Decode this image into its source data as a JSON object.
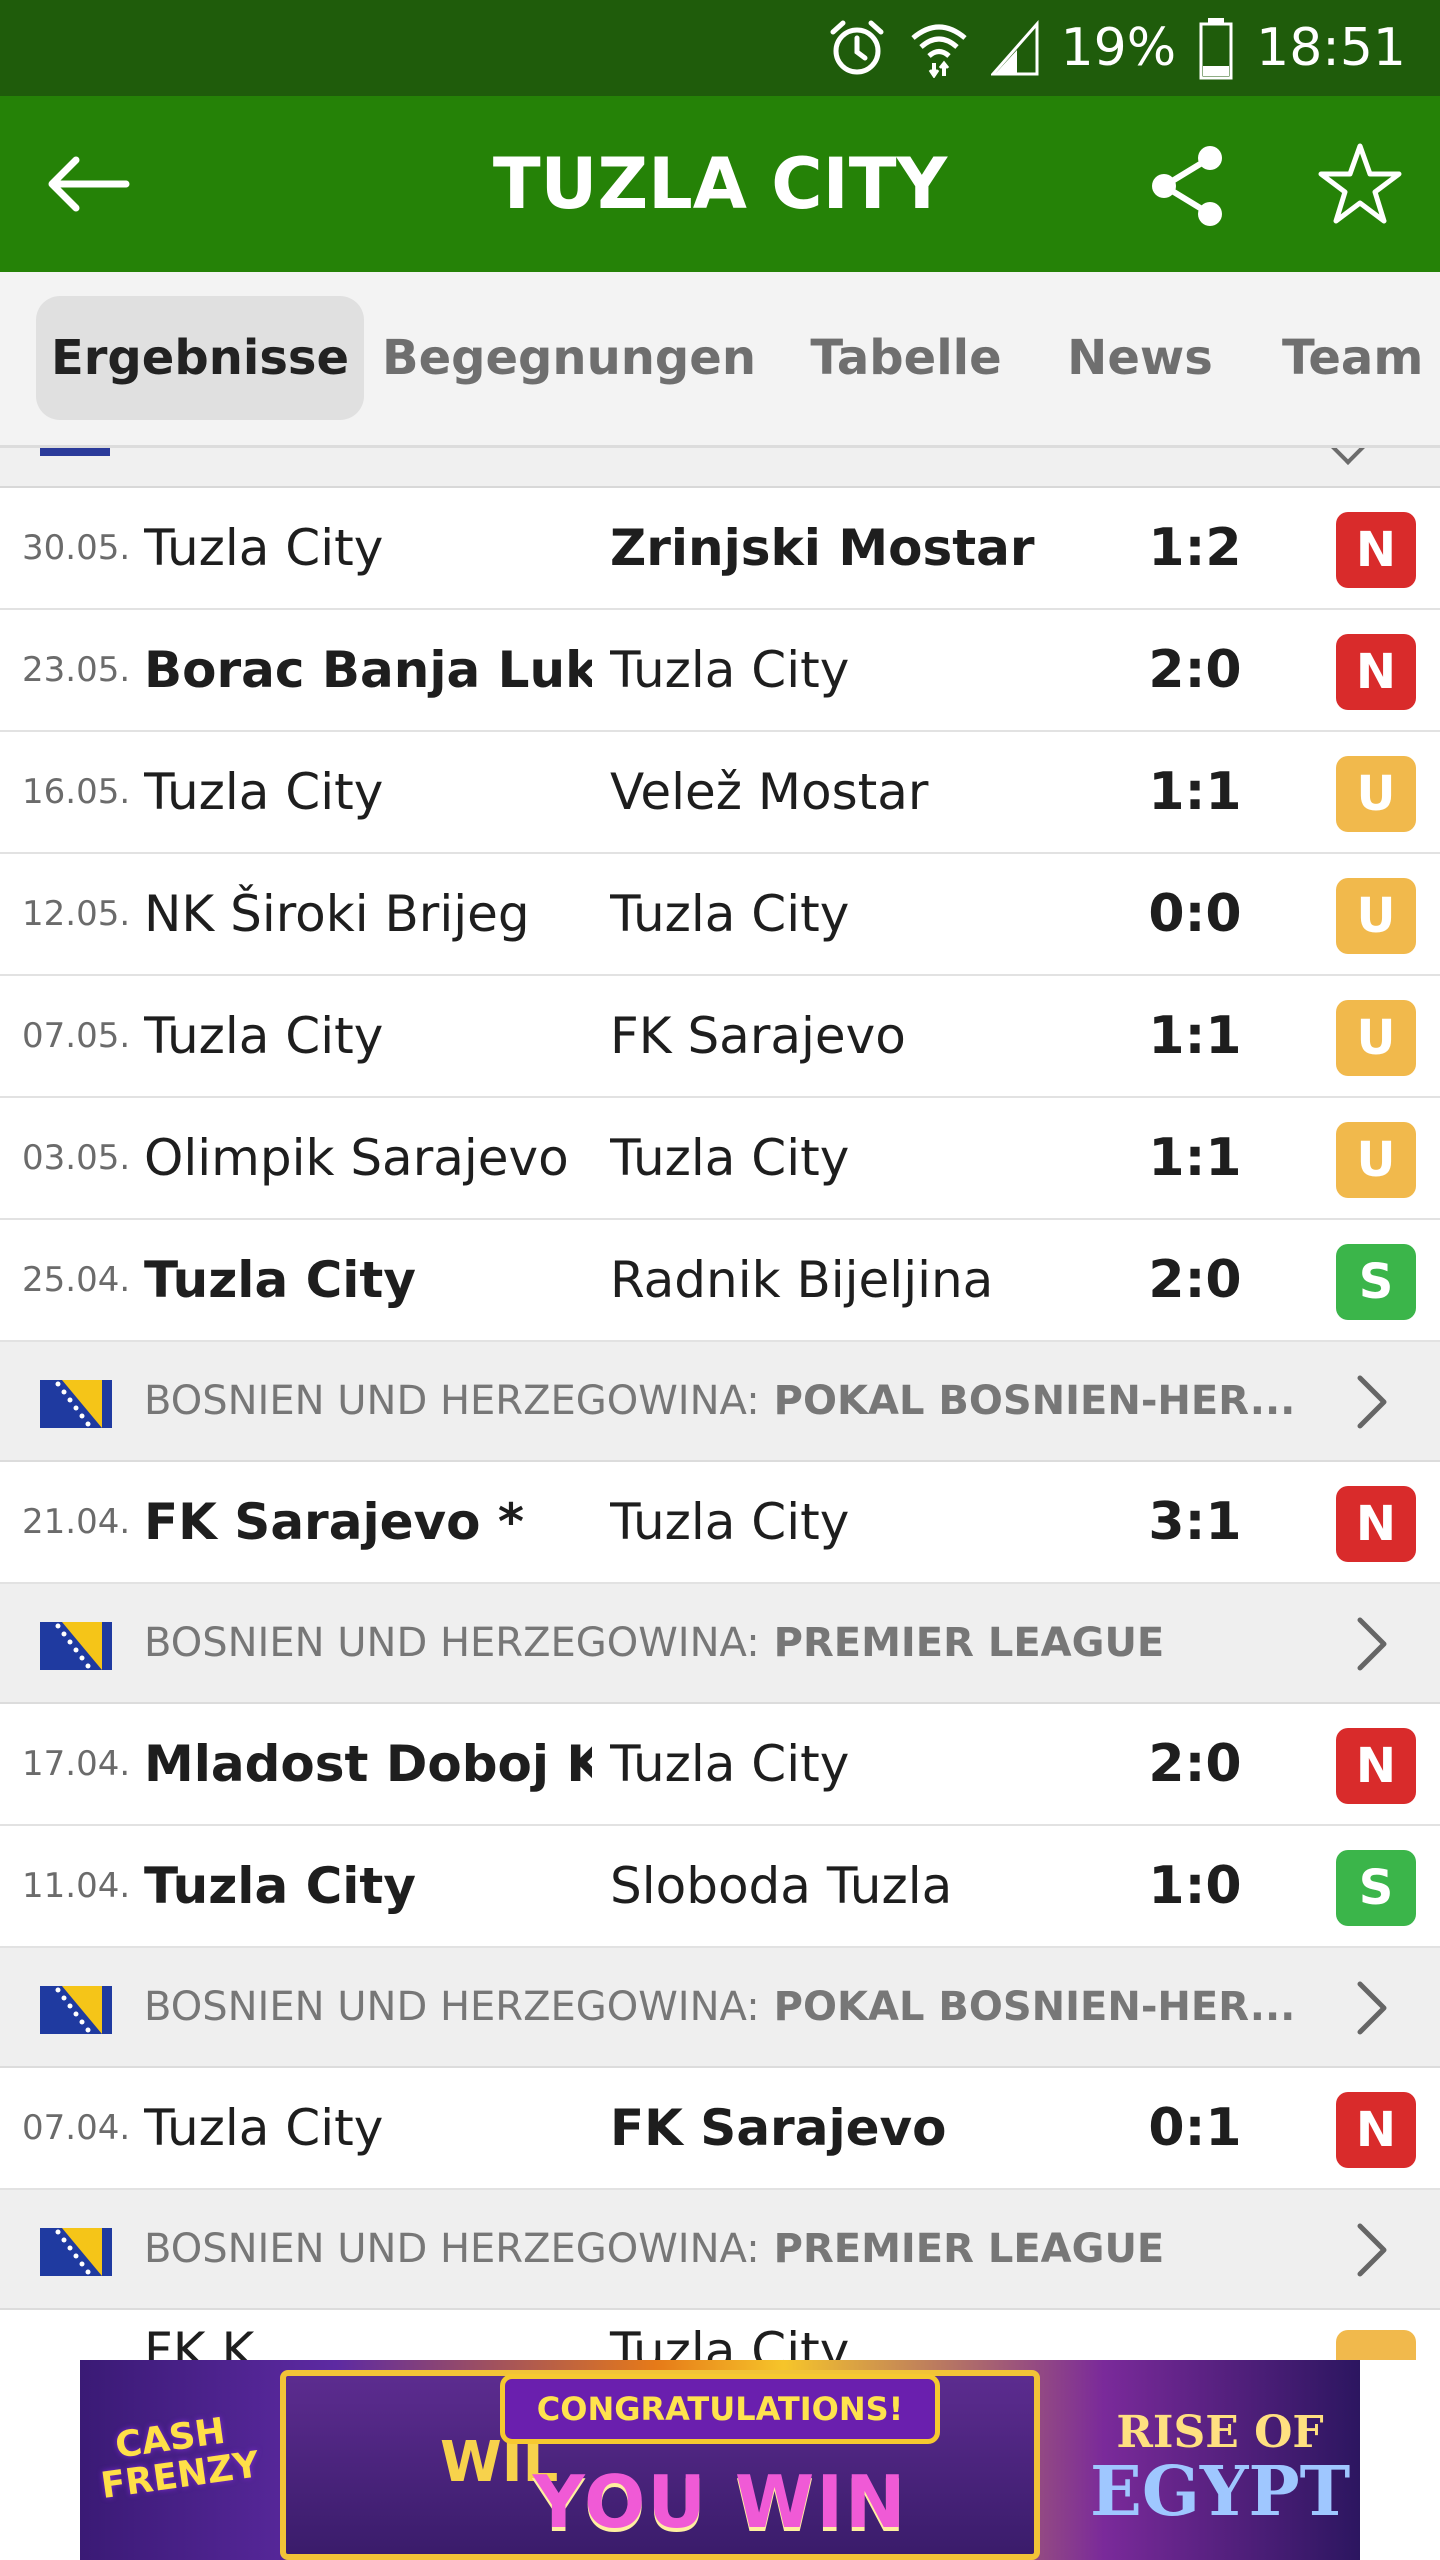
{
  "status_bar": {
    "battery": "19%",
    "time": "18:51"
  },
  "app_bar": {
    "title": "TUZLA CITY"
  },
  "tabs": [
    "Ergebnisse",
    "Begegnungen",
    "Tabelle",
    "News",
    "Team"
  ],
  "rows": [
    {
      "date": "30.05.",
      "home": "Tuzla City",
      "away": "Zrinjski Mostar",
      "score": "1:2",
      "result": "N"
    },
    {
      "date": "23.05.",
      "home": "Borac Banja Luka",
      "away": "Tuzla City",
      "score": "2:0",
      "result": "N"
    },
    {
      "date": "16.05.",
      "home": "Tuzla City",
      "away": "Velež Mostar",
      "score": "1:1",
      "result": "U"
    },
    {
      "date": "12.05.",
      "home": "NK Široki Brijeg",
      "away": "Tuzla City",
      "score": "0:0",
      "result": "U"
    },
    {
      "date": "07.05.",
      "home": "Tuzla City",
      "away": "FK Sarajevo",
      "score": "1:1",
      "result": "U"
    },
    {
      "date": "03.05.",
      "home": "Olimpik Sarajevo",
      "away": "Tuzla City",
      "score": "1:1",
      "result": "U"
    },
    {
      "date": "25.04.",
      "home": "Tuzla City",
      "away": "Radnik Bijeljina",
      "score": "2:0",
      "result": "S"
    },
    {
      "date": "21.04.",
      "home": "FK Sarajevo *",
      "away": "Tuzla City",
      "score": "3:1",
      "result": "N"
    },
    {
      "date": "17.04.",
      "home": "Mladost Doboj K...",
      "away": "Tuzla City",
      "score": "2:0",
      "result": "N"
    },
    {
      "date": "11.04.",
      "home": "Tuzla City",
      "away": "Sloboda Tuzla",
      "score": "1:0",
      "result": "S"
    },
    {
      "date": "07.04.",
      "home": "Tuzla City",
      "away": "FK Sarajevo",
      "score": "0:1",
      "result": "N"
    }
  ],
  "leagues": [
    {
      "country": "BOSNIEN UND HERZEGOWINA:",
      "competition": "POKAL BOSNIEN-HER..."
    },
    {
      "country": "BOSNIEN UND HERZEGOWINA:",
      "competition": "PREMIER LEAGUE"
    },
    {
      "country": "BOSNIEN UND HERZEGOWINA:",
      "competition": "POKAL BOSNIEN-HER..."
    },
    {
      "country": "BOSNIEN UND HERZEGOWINA:",
      "competition": "PREMIER LEAGUE"
    }
  ],
  "partial_row": {
    "home": "FK K",
    "away": "Tuzla City"
  },
  "result_colors": {
    "N": "#d92b2b",
    "U": "#f1b94c",
    "S": "#3bb54a"
  },
  "ad": {
    "left_logo": "CASH FRENZY",
    "wild": "WIL",
    "headline": "CONGRATULATIONS!",
    "subline": "YOU WIN",
    "right_logo_top": "RISE OF",
    "right_logo_bottom": "EGYPT"
  }
}
